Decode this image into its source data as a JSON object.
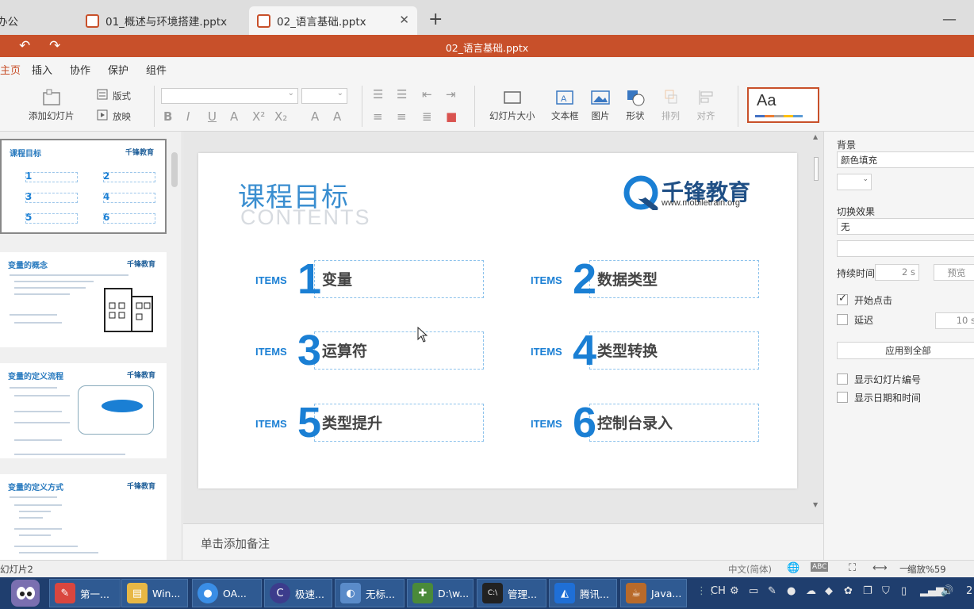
{
  "tabs": [
    {
      "label": "办公",
      "active": false
    },
    {
      "label": "01_概述与环境搭建.pptx",
      "active": false
    },
    {
      "label": "02_语言基础.pptx",
      "active": true
    }
  ],
  "title": {
    "document": "02_语言基础.pptx"
  },
  "menu": [
    "主页",
    "插入",
    "协作",
    "保护",
    "组件"
  ],
  "ribbon": {
    "add_slide": "添加幻灯片",
    "layout": "版式",
    "play": "放映",
    "slide_size": "幻灯片大小",
    "textbox": "文本框",
    "picture": "图片",
    "shape": "形状",
    "arrange": "排列",
    "align": "对齐",
    "theme_preview": "Aa"
  },
  "thumbnails": [
    {
      "title": "课程目标",
      "logo": "千锋教育"
    },
    {
      "title": "变量的概念",
      "logo": "千锋教育"
    },
    {
      "title": "变量的定义流程",
      "logo": "千锋教育"
    },
    {
      "title": "变量的定义方式",
      "logo": "千锋教育"
    }
  ],
  "slide": {
    "title": "课程目标",
    "subtitle": "CONTENTS",
    "logo_name": "千锋教育",
    "logo_url": "www.mobiletrain.org",
    "items_label": "ITEMS",
    "items": [
      {
        "num": "1",
        "label": "变量"
      },
      {
        "num": "2",
        "label": "数据类型"
      },
      {
        "num": "3",
        "label": "运算符"
      },
      {
        "num": "4",
        "label": "类型转换"
      },
      {
        "num": "5",
        "label": "类型提升"
      },
      {
        "num": "6",
        "label": "控制台录入"
      }
    ]
  },
  "notes_placeholder": "单击添加备注",
  "right_pane": {
    "background_label": "背景",
    "background_value": "颜色填充",
    "transition_label": "切换效果",
    "transition_value": "无",
    "duration_label": "持续时间",
    "duration_value": "2 s",
    "preview_button": "预览",
    "on_click_label": "开始点击",
    "on_click_checked": true,
    "delay_label": "延迟",
    "delay_checked": false,
    "delay_value": "10 s",
    "apply_all_button": "应用到全部",
    "show_slide_number": "显示幻灯片编号",
    "show_datetime": "显示日期和时间"
  },
  "status": {
    "slide_info": "幻灯片2",
    "language": "中文(简体)",
    "zoom": "缩放%59"
  },
  "taskbar": [
    {
      "label": "第一...",
      "color": "#d9463f"
    },
    {
      "label": "Win...",
      "color": "#e7b745"
    },
    {
      "label": "OA...",
      "color": "#3a8ee6"
    },
    {
      "label": "极速...",
      "color": "#3c3c8c"
    },
    {
      "label": "无标...",
      "color": "#5a8bc9"
    },
    {
      "label": "D:\\w...",
      "color": "#4a8a3a"
    },
    {
      "label": "管理...",
      "color": "#222222"
    },
    {
      "label": "腾讯...",
      "color": "#1f6fd6"
    },
    {
      "label": "Java...",
      "color": "#b86a2a"
    }
  ],
  "tray": {
    "input": "CH",
    "clock": "2"
  },
  "colors": {
    "accent": "#c8502a",
    "slide_blue": "#1a7fd4",
    "taskbar": "#1f3e6e"
  }
}
